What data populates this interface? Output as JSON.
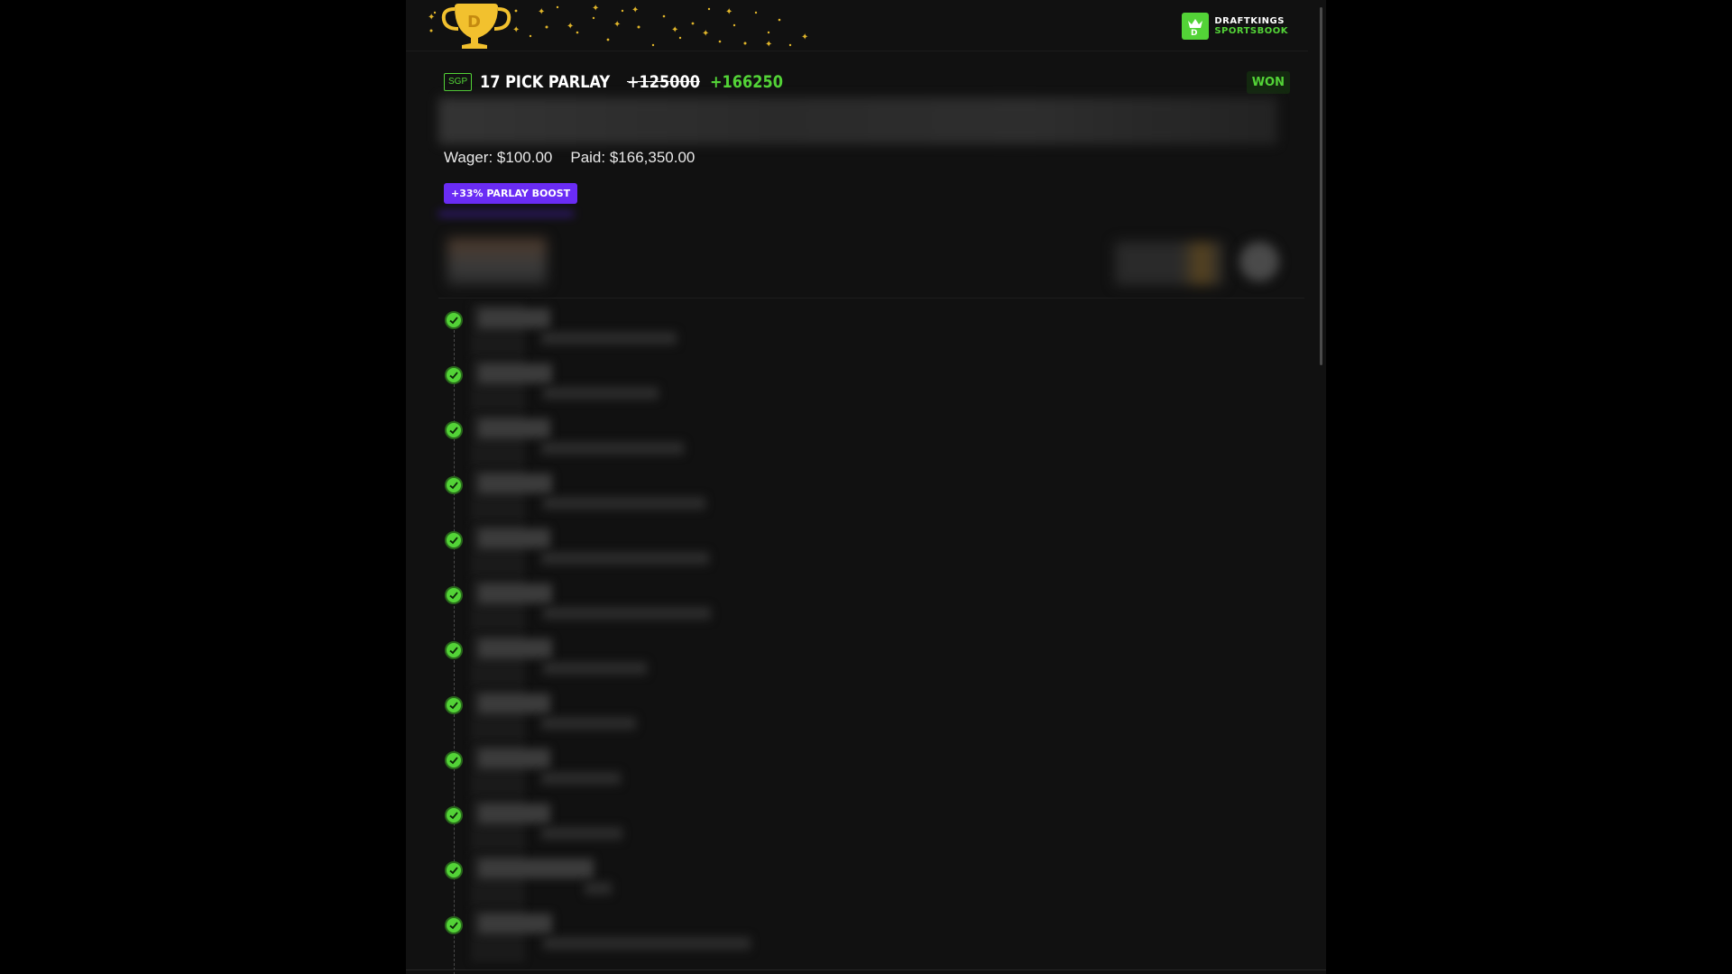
{
  "header": {
    "brand_line1": "DRAFTKINGS",
    "brand_line2": "SPORTSBOOK",
    "trophy_icon": "trophy-icon",
    "logo_icon": "draftkings-crown-icon"
  },
  "bet": {
    "tag": "SGP",
    "title": "17 PICK PARLAY",
    "odds_original": "+125000",
    "odds_boosted": "+166250",
    "status": "WON",
    "wager_label": "Wager:",
    "wager_value": "$100.00",
    "paid_label": "Paid:",
    "paid_value": "$166,350.00",
    "boost_label": "+33% PARLAY BOOST"
  },
  "colors": {
    "accent_green": "#53d337",
    "boost_purple": "#6a2cf5",
    "background": "#111111",
    "trophy_gold": "#f2c12e"
  },
  "legs": [
    {
      "status": "won"
    },
    {
      "status": "won"
    },
    {
      "status": "won"
    },
    {
      "status": "won"
    },
    {
      "status": "won"
    },
    {
      "status": "won"
    },
    {
      "status": "won"
    },
    {
      "status": "won"
    },
    {
      "status": "won"
    },
    {
      "status": "won"
    },
    {
      "status": "won"
    },
    {
      "status": "won"
    }
  ]
}
